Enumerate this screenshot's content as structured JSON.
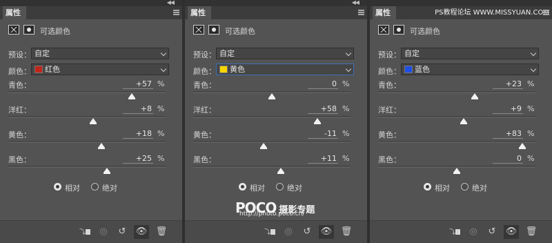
{
  "watermark_site": "PS教程论坛 WWW.MISSYUAN.COM",
  "watermark_brand": "POCO",
  "watermark_brand_sub": "摄影专题",
  "watermark_url": "http://photo.poco.cn/",
  "panels": [
    {
      "tab": "属性",
      "title": "可选颜色",
      "preset_label": "预设：",
      "preset_value": "自定",
      "color_label": "颜色：",
      "color_value": "红色",
      "swatch": "#c0261b",
      "sliders": [
        {
          "label": "青色：",
          "value": "+57",
          "pct": "%",
          "level": 57
        },
        {
          "label": "洋红：",
          "value": "+8",
          "pct": "%",
          "level": 8
        },
        {
          "label": "黄色：",
          "value": "+18",
          "pct": "%",
          "level": 18
        },
        {
          "label": "黑色：",
          "value": "+25",
          "pct": "%",
          "level": 25
        }
      ],
      "radio_relative": "相对",
      "radio_absolute": "绝对",
      "relative_selected": true
    },
    {
      "tab": "属性",
      "title": "可选颜色",
      "preset_label": "预设：",
      "preset_value": "自定",
      "color_label": "颜色：",
      "color_value": "黄色",
      "swatch": "#f7d500",
      "sliders": [
        {
          "label": "青色：",
          "value": "0",
          "pct": "%",
          "level": 0
        },
        {
          "label": "洋红：",
          "value": "+58",
          "pct": "%",
          "level": 58
        },
        {
          "label": "黄色：",
          "value": "-11",
          "pct": "%",
          "level": -11
        },
        {
          "label": "黑色：",
          "value": "+11",
          "pct": "%",
          "level": 11
        }
      ],
      "radio_relative": "相对",
      "radio_absolute": "绝对",
      "relative_selected": true
    },
    {
      "tab": "属性",
      "title": "可选颜色",
      "preset_label": "预设：",
      "preset_value": "自定",
      "color_label": "颜色：",
      "color_value": "蓝色",
      "swatch": "#1d4fe6",
      "sliders": [
        {
          "label": "青色：",
          "value": "+23",
          "pct": "%",
          "level": 23
        },
        {
          "label": "洋红：",
          "value": "+9",
          "pct": "%",
          "level": 9
        },
        {
          "label": "黄色：",
          "value": "+83",
          "pct": "%",
          "level": 83
        },
        {
          "label": "黑色：",
          "value": "0",
          "pct": "%",
          "level": 0
        }
      ],
      "radio_relative": "相对",
      "radio_absolute": "绝对",
      "relative_selected": true
    }
  ]
}
